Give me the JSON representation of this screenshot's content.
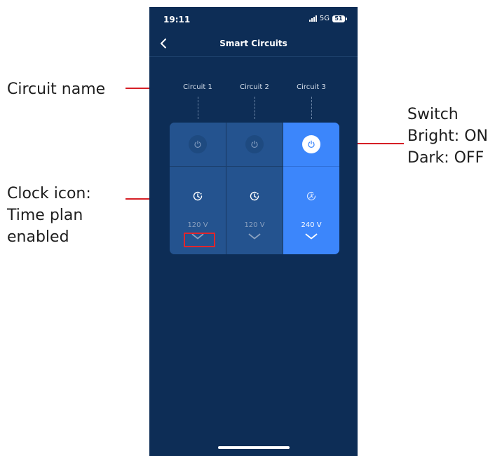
{
  "annotations": {
    "circuit_name": "Circuit name",
    "clock_line1": "Clock icon:",
    "clock_line2": "Time plan",
    "clock_line3": "enabled",
    "switch_line1": "Switch",
    "switch_line2": "Bright: ON",
    "switch_line3": "Dark: OFF"
  },
  "status_bar": {
    "time": "19:11",
    "network": "5G",
    "battery": "51"
  },
  "nav": {
    "title": "Smart Circuits"
  },
  "circuits": [
    {
      "name": "Circuit 1",
      "voltage": "120 V",
      "switch_on": false,
      "time_plan": true
    },
    {
      "name": "Circuit 2",
      "voltage": "120 V",
      "switch_on": false,
      "time_plan": true
    },
    {
      "name": "Circuit 3",
      "voltage": "240 V",
      "switch_on": true,
      "time_plan": false
    }
  ],
  "colors": {
    "background": "#0d2d56",
    "tile_off": "#24538f",
    "tile_on": "#3c86fb",
    "annotation_red": "#d61f26"
  },
  "icons": {
    "back": "chevron-left-icon",
    "power": "power-icon",
    "clock": "clock-icon",
    "expand": "chevron-down-icon"
  }
}
